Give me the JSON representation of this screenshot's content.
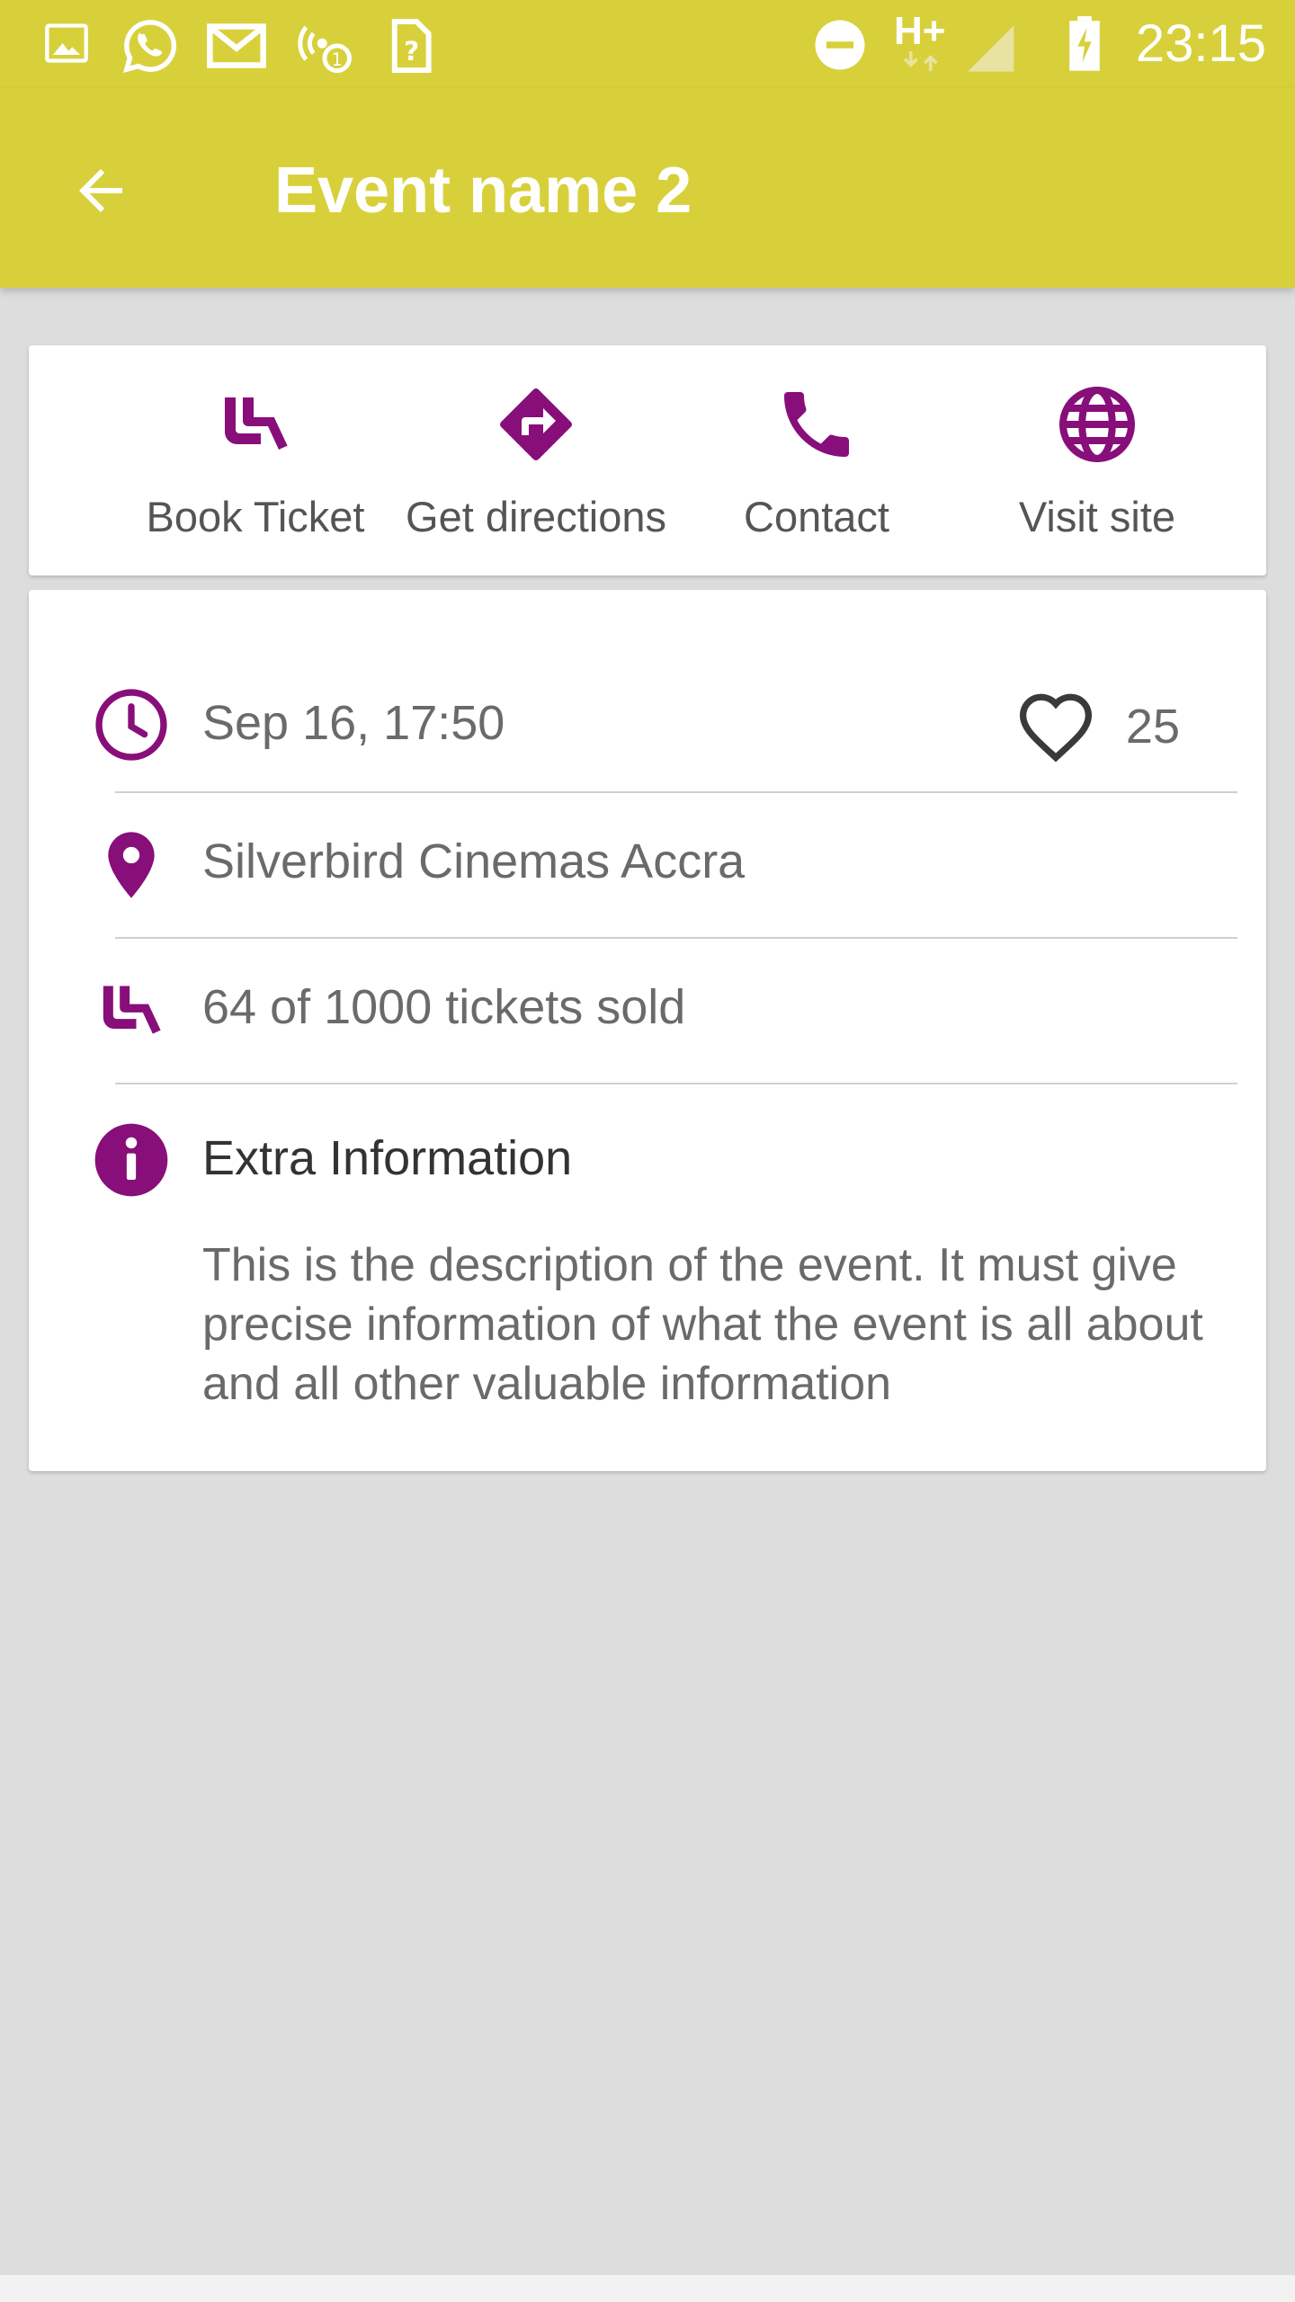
{
  "status_bar": {
    "time": "23:15",
    "network": "H+",
    "icons": [
      "image-icon",
      "whatsapp-icon",
      "gmail-icon",
      "hotspot-icon",
      "sim-icon",
      "dnd-icon",
      "signal-icon",
      "battery-charging-icon"
    ]
  },
  "app_bar": {
    "title": "Event name 2",
    "back_icon": "arrow-back-icon"
  },
  "actions": [
    {
      "label": "Book Ticket",
      "icon": "seat-icon"
    },
    {
      "label": "Get directions",
      "icon": "directions-icon"
    },
    {
      "label": "Contact",
      "icon": "phone-icon"
    },
    {
      "label": "Visit site",
      "icon": "globe-icon"
    }
  ],
  "details": {
    "datetime": "Sep 16, 17:50",
    "likes": "25",
    "location": "Silverbird Cinemas Accra",
    "tickets": "64 of 1000 tickets sold",
    "extra_title": "Extra Information",
    "description": "This is the description of the event. It must give precise information of what the event is all about and all other valuable information"
  },
  "colors": {
    "app_bar": "#d8d03a",
    "accent": "#880e7a",
    "background": "#dddddd"
  }
}
